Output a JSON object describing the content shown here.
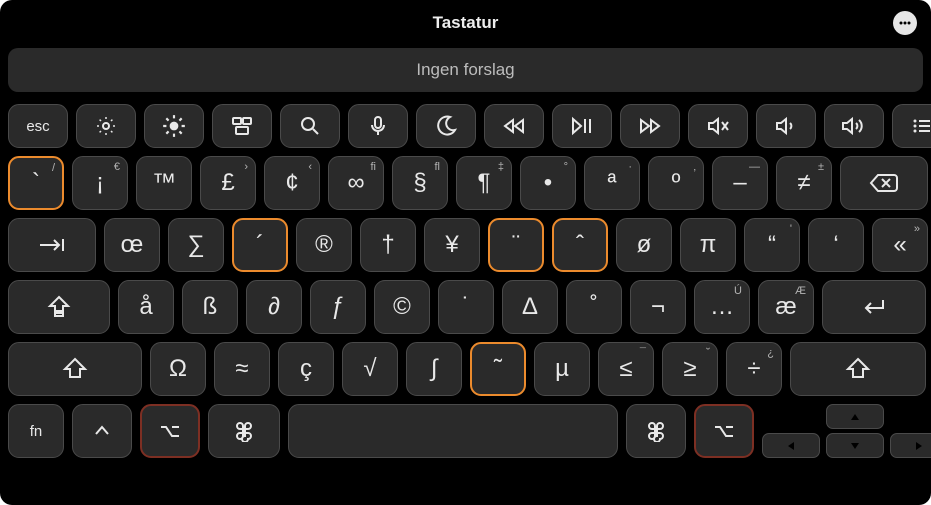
{
  "title": "Tastatur",
  "suggestion_bar": "Ingen forslag",
  "fn_row": {
    "esc": "esc"
  },
  "row1": [
    {
      "m": "`",
      "s": "/",
      "hl": "orange"
    },
    {
      "m": "¡",
      "s": "€"
    },
    {
      "m": "™",
      "s": ""
    },
    {
      "m": "£",
      "s": "›"
    },
    {
      "m": "¢",
      "s": "‹"
    },
    {
      "m": "∞",
      "s": "fi"
    },
    {
      "m": "§",
      "s": "fl"
    },
    {
      "m": "¶",
      "s": "‡"
    },
    {
      "m": "•",
      "s": "°"
    },
    {
      "m": "ª",
      "s": "·"
    },
    {
      "m": "º",
      "s": "‚"
    },
    {
      "m": "–",
      "s": "—"
    },
    {
      "m": "≠",
      "s": "±"
    }
  ],
  "row2": [
    {
      "m": "œ",
      "s": ""
    },
    {
      "m": "∑",
      "s": ""
    },
    {
      "m": "´",
      "s": "",
      "hl": "orange"
    },
    {
      "m": "®",
      "s": ""
    },
    {
      "m": "†",
      "s": ""
    },
    {
      "m": "¥",
      "s": ""
    },
    {
      "m": "¨",
      "s": "",
      "hl": "orange"
    },
    {
      "m": "ˆ",
      "s": "",
      "hl": "orange"
    },
    {
      "m": "ø",
      "s": ""
    },
    {
      "m": "π",
      "s": ""
    },
    {
      "m": "“",
      "s": "'"
    },
    {
      "m": "‘",
      "s": ""
    },
    {
      "m": "«",
      "s": "»"
    }
  ],
  "row3": [
    {
      "m": "å",
      "s": ""
    },
    {
      "m": "ß",
      "s": ""
    },
    {
      "m": "∂",
      "s": ""
    },
    {
      "m": "ƒ",
      "s": ""
    },
    {
      "m": "©",
      "s": ""
    },
    {
      "m": "˙",
      "s": ""
    },
    {
      "m": "∆",
      "s": ""
    },
    {
      "m": "˚",
      "s": ""
    },
    {
      "m": "¬",
      "s": ""
    },
    {
      "m": "…",
      "s": "Ú"
    },
    {
      "m": "æ",
      "s": "Æ"
    }
  ],
  "row4": [
    {
      "m": "Ω",
      "s": ""
    },
    {
      "m": "≈",
      "s": ""
    },
    {
      "m": "ç",
      "s": ""
    },
    {
      "m": "√",
      "s": ""
    },
    {
      "m": "∫",
      "s": ""
    },
    {
      "m": "˜",
      "s": "",
      "hl": "orange"
    },
    {
      "m": "µ",
      "s": ""
    },
    {
      "m": "≤",
      "s": "¯"
    },
    {
      "m": "≥",
      "s": "˘"
    },
    {
      "m": "÷",
      "s": "¿"
    }
  ],
  "row5": {
    "fn": "fn"
  }
}
